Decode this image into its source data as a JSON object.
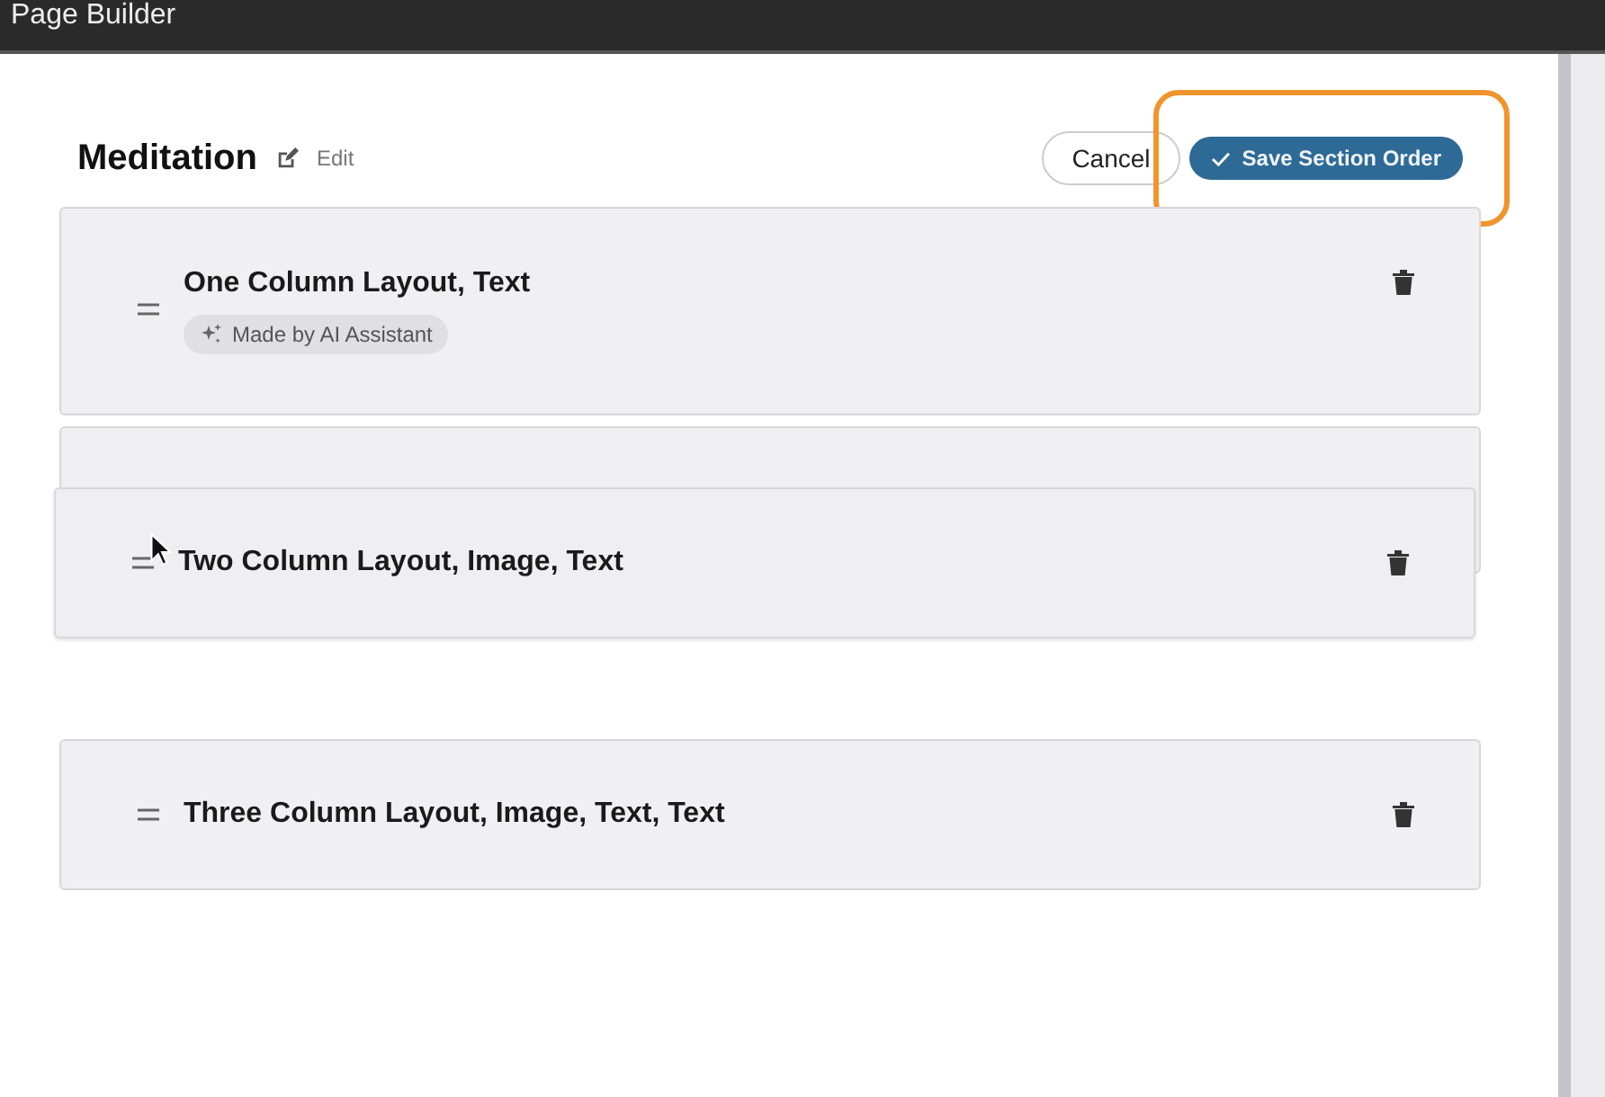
{
  "window": {
    "title": "Page Builder"
  },
  "page": {
    "title": "Meditation",
    "edit_label": "Edit"
  },
  "buttons": {
    "cancel": "Cancel",
    "save": "Save Section Order",
    "save_highlighted": true
  },
  "sections": [
    {
      "title": "One Column Layout, Text",
      "badge": "Made by AI Assistant",
      "dragging": false
    },
    {
      "title": "Two Column Layout, Image, Text",
      "dragging": true
    },
    {
      "title": "Three Column Layout, Image, Text, Text",
      "dragging": false
    }
  ]
}
